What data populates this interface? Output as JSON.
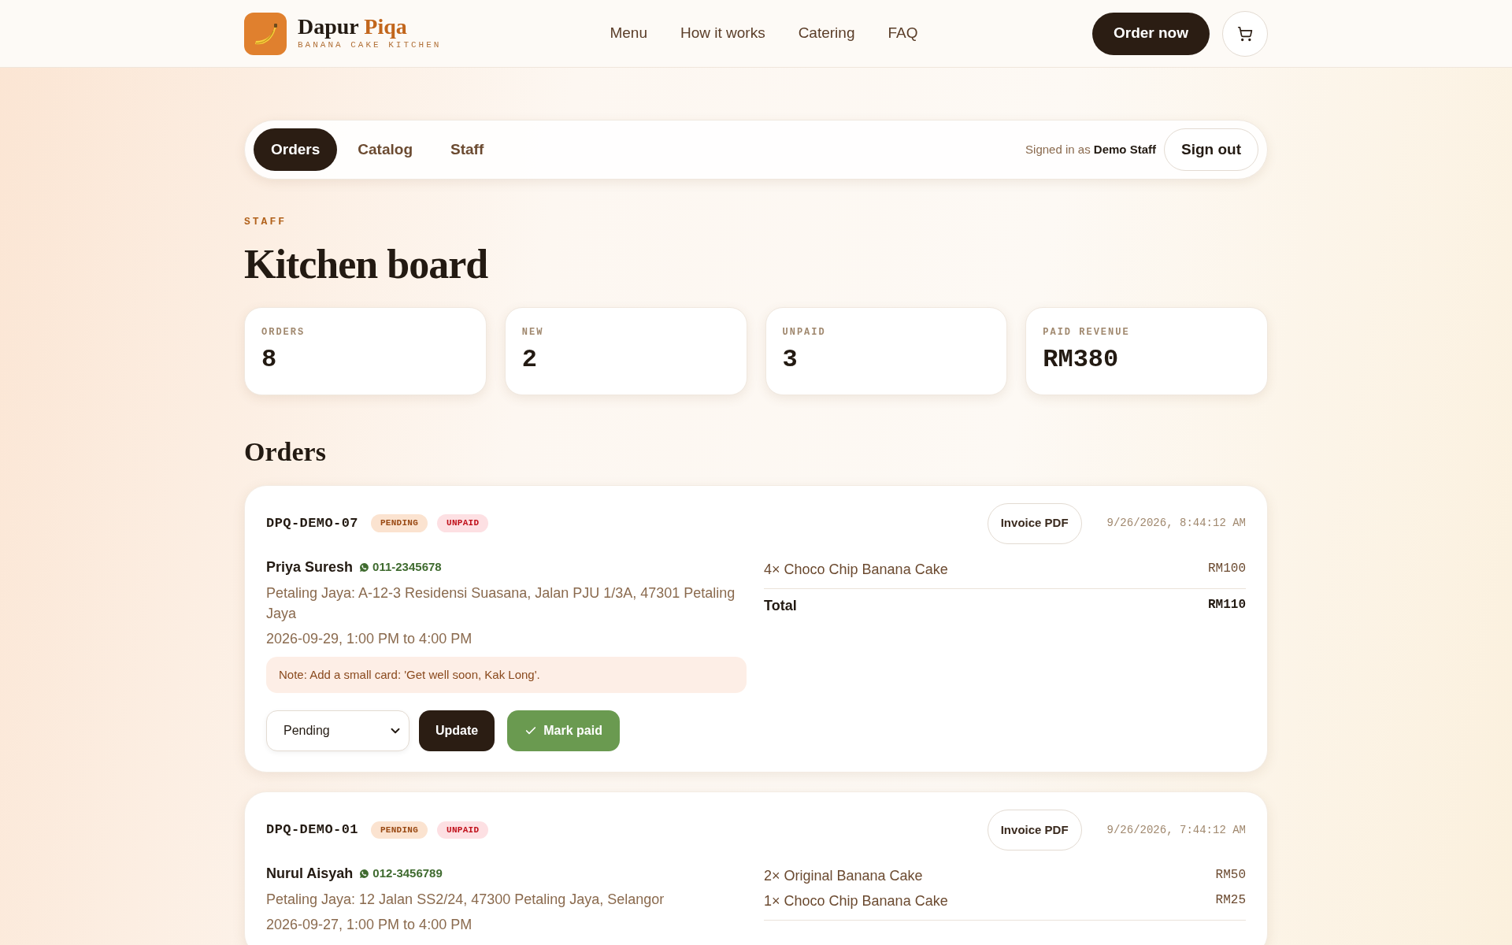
{
  "brand": {
    "name": "Dapur",
    "name_accent": "Piqa",
    "tagline": "BANANA CAKE KITCHEN"
  },
  "nav": [
    "Menu",
    "How it works",
    "Catering",
    "FAQ"
  ],
  "order_now": "Order now",
  "tabs": [
    {
      "label": "Orders",
      "selected": true
    },
    {
      "label": "Catalog",
      "selected": false
    },
    {
      "label": "Staff",
      "selected": false
    }
  ],
  "signed_in": {
    "prefix": "Signed in as",
    "name": "Demo Staff"
  },
  "sign_out": "Sign out",
  "eyebrow": "STAFF",
  "title": "Kitchen board",
  "stats": [
    {
      "label": "ORDERS",
      "value": "8"
    },
    {
      "label": "NEW",
      "value": "2"
    },
    {
      "label": "UNPAID",
      "value": "3"
    },
    {
      "label": "PAID REVENUE",
      "value": "RM380"
    }
  ],
  "orders_heading": "Orders",
  "orders": [
    {
      "id": "DPQ-DEMO-07",
      "badges": [
        {
          "kind": "status",
          "text": "PENDING"
        },
        {
          "kind": "payment",
          "text": "UNPAID"
        }
      ],
      "invoice": "Invoice PDF",
      "time": "9/26/2026, 8:44:12 AM",
      "customer": "Priya Suresh",
      "phone": "011-2345678",
      "address": "Petaling Jaya: A-12-3 Residensi Suasana, Jalan PJU 1/3A, 47301 Petaling Jaya",
      "slot": "2026-09-29, 1:00 PM to 4:00 PM",
      "note": "Note: Add a small card: 'Get well soon, Kak Long'.",
      "items": [
        {
          "name": "4× Choco Chip Banana Cake",
          "price": "RM100"
        }
      ],
      "total": {
        "label": "Total",
        "value": "RM110"
      },
      "status_select": "Pending",
      "update": "Update",
      "mark_paid": "Mark paid"
    },
    {
      "id": "DPQ-DEMO-01",
      "badges": [
        {
          "kind": "status",
          "text": "PENDING"
        },
        {
          "kind": "payment",
          "text": "UNPAID"
        }
      ],
      "invoice": "Invoice PDF",
      "time": "9/26/2026, 7:44:12 AM",
      "customer": "Nurul Aisyah",
      "phone": "012-3456789",
      "address": "Petaling Jaya: 12 Jalan SS2/24, 47300 Petaling Jaya, Selangor",
      "slot": "2026-09-27, 1:00 PM to 4:00 PM",
      "items": [
        {
          "name": "2× Original Banana Cake",
          "price": "RM50"
        },
        {
          "name": "1× Choco Chip Banana Cake",
          "price": "RM25"
        }
      ]
    }
  ]
}
